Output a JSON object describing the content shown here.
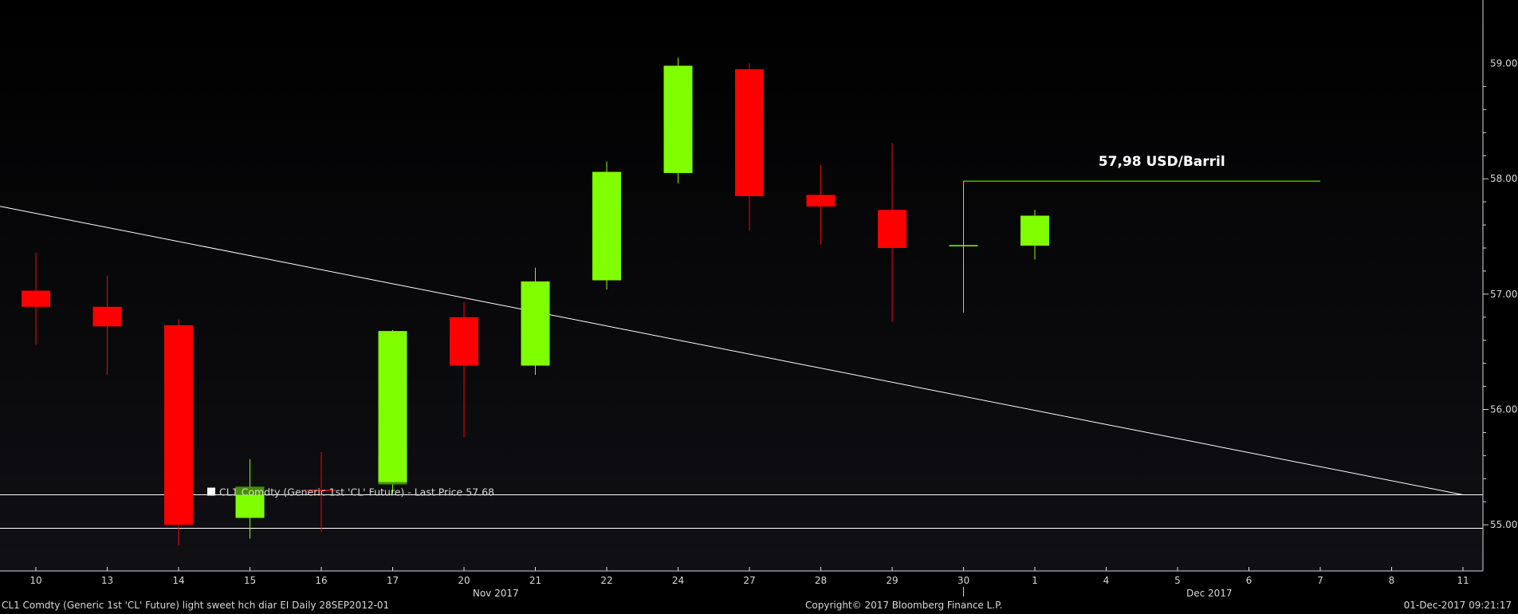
{
  "chart_data": {
    "type": "candlestick",
    "security": "CL1 Comdty (Generic 1st 'CL' Future) light sweet hch diar EI  Daily 28SEP2012-01",
    "legend": "CL1 Comdty (Generic 1st 'CL' Future) - Last Price 57.68",
    "annotation": "57,98 USD/Barril",
    "annotation_value": 57.98,
    "y_ticks": [
      "55.00",
      "56.00",
      "57.00",
      "58.00",
      "59.00"
    ],
    "x_ticks": [
      "10",
      "13",
      "14",
      "15",
      "16",
      "17",
      "20",
      "21",
      "22",
      "24",
      "27",
      "28",
      "29",
      "30",
      "1",
      "4",
      "5",
      "6",
      "7",
      "8",
      "11"
    ],
    "month_labels": [
      {
        "label": "Nov 2017",
        "after_tick": 6
      },
      {
        "label": "Dec 2017",
        "after_tick": 16
      }
    ],
    "ylim": [
      54.6,
      59.55
    ],
    "candles": [
      {
        "date": "10",
        "open": 57.03,
        "high": 57.36,
        "low": 56.56,
        "close": 56.89
      },
      {
        "date": "13",
        "open": 56.89,
        "high": 57.16,
        "low": 56.3,
        "close": 56.72
      },
      {
        "date": "14",
        "open": 56.73,
        "high": 56.78,
        "low": 54.82,
        "close": 55.0
      },
      {
        "date": "15",
        "open": 55.06,
        "high": 55.57,
        "low": 54.88,
        "close": 55.33
      },
      {
        "date": "16",
        "open": 55.3,
        "high": 55.63,
        "low": 54.94,
        "close": 55.29
      },
      {
        "date": "17",
        "open": 55.35,
        "high": 56.69,
        "low": 55.27,
        "close": 56.68
      },
      {
        "date": "20",
        "open": 56.8,
        "high": 56.93,
        "low": 55.76,
        "close": 56.38
      },
      {
        "date": "21",
        "open": 56.38,
        "high": 57.23,
        "low": 56.3,
        "close": 57.11
      },
      {
        "date": "22",
        "open": 57.12,
        "high": 58.15,
        "low": 57.04,
        "close": 58.06
      },
      {
        "date": "24",
        "open": 58.05,
        "high": 59.05,
        "low": 57.96,
        "close": 58.98
      },
      {
        "date": "27",
        "open": 58.95,
        "high": 59.0,
        "low": 57.55,
        "close": 57.85
      },
      {
        "date": "28",
        "open": 57.86,
        "high": 58.12,
        "low": 57.43,
        "close": 57.76
      },
      {
        "date": "29",
        "open": 57.73,
        "high": 58.31,
        "low": 56.76,
        "close": 57.4
      },
      {
        "date": "30",
        "open": 57.42,
        "high": 57.42,
        "low": 56.84,
        "close": 57.42
      },
      {
        "date": "1",
        "open": 57.42,
        "high": 57.73,
        "low": 57.3,
        "close": 57.68
      }
    ],
    "trendline": [
      {
        "x": "10",
        "y": 57.7
      },
      {
        "x": "11",
        "y": 55.26
      }
    ],
    "horizontal_lines": [
      55.26,
      54.97
    ],
    "colors": {
      "up": "#80ff00",
      "down": "#ff0000",
      "up_dark": "#3d7a00",
      "grid_line": "#ffffff",
      "axis": "#d8d8d8",
      "background_top": "#000000",
      "background_bottom": "#101014"
    }
  },
  "footer": {
    "left": "CL1 Comdty (Generic 1st 'CL' Future) light sweet hch diar EI  Daily 28SEP2012-01",
    "center": "Copyright© 2017 Bloomberg Finance L.P.",
    "right": "01-Dec-2017 09:21:17"
  }
}
